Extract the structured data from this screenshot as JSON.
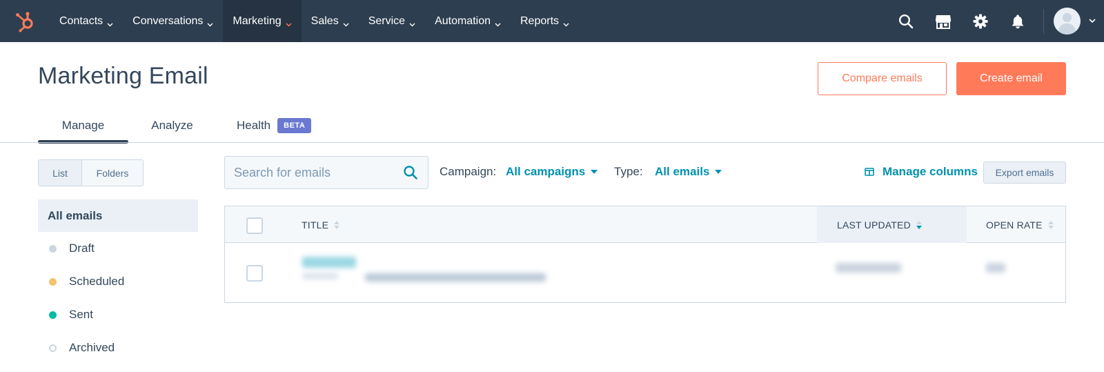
{
  "nav": {
    "items": [
      {
        "label": "Contacts",
        "name": "nav-contacts",
        "active": false
      },
      {
        "label": "Conversations",
        "name": "nav-conversations",
        "active": false
      },
      {
        "label": "Marketing",
        "name": "nav-marketing",
        "active": true
      },
      {
        "label": "Sales",
        "name": "nav-sales",
        "active": false
      },
      {
        "label": "Service",
        "name": "nav-service",
        "active": false
      },
      {
        "label": "Automation",
        "name": "nav-automation",
        "active": false
      },
      {
        "label": "Reports",
        "name": "nav-reports",
        "active": false
      }
    ],
    "icons": [
      "search-icon",
      "marketplace-icon",
      "gear-icon",
      "bell-icon"
    ],
    "colors": {
      "bar": "#2d3e50",
      "active": "#253342",
      "accent": "#ff7a59"
    }
  },
  "header": {
    "title": "Marketing Email",
    "compare_label": "Compare emails",
    "create_label": "Create email"
  },
  "tabs": {
    "manage": "Manage",
    "analyze": "Analyze",
    "health": "Health",
    "beta": "BETA"
  },
  "sidebar": {
    "list_label": "List",
    "folders_label": "Folders",
    "all_label": "All emails",
    "items": [
      {
        "label": "Draft",
        "color": "#cbd6e2",
        "hollow": false
      },
      {
        "label": "Scheduled",
        "color": "#f5c26b",
        "hollow": false
      },
      {
        "label": "Sent",
        "color": "#00bda5",
        "hollow": false
      },
      {
        "label": "Archived",
        "color": "#cbd6e2",
        "hollow": true
      }
    ]
  },
  "toolbar": {
    "search_placeholder": "Search for emails",
    "campaign_label": "Campaign:",
    "campaign_value": "All campaigns",
    "type_label": "Type:",
    "type_value": "All emails",
    "manage_columns": "Manage columns",
    "export_label": "Export emails"
  },
  "table": {
    "col_title": "TITLE",
    "col_updated": "LAST UPDATED",
    "col_open_rate": "OPEN RATE"
  }
}
